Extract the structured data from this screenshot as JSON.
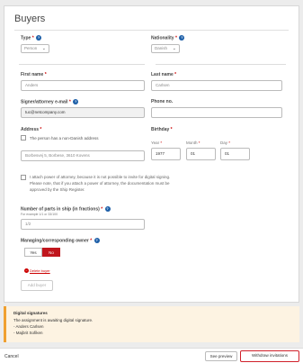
{
  "card": {
    "title": "Buyers"
  },
  "type": {
    "label": "Type",
    "selected": "Person"
  },
  "nationality": {
    "label": "Nationality",
    "selected": "Danish"
  },
  "first_name": {
    "label": "First name",
    "value": "Anders"
  },
  "last_name": {
    "label": "Last name",
    "value": "Carlsen"
  },
  "email": {
    "label": "Signer/attorney e-mail",
    "value": "tuc@netcompany.com"
  },
  "phone": {
    "label": "Phone no.",
    "value": ""
  },
  "address": {
    "label": "Address",
    "non_danish_label": "The person has a non-Danish address",
    "value": "Borbesvej 5, Borbese, 3610 Kovens"
  },
  "birthday": {
    "label": "Birthday",
    "year_label": "Year",
    "month_label": "Month",
    "day_label": "Day",
    "year": "1977",
    "month": "01",
    "day": "01"
  },
  "attorney": {
    "text": "I attach power of attorney, because it is not possible to invite for digital signing. Please note, that if you attach a power of attorney, the documentation must be approved by the Ship Register."
  },
  "parts": {
    "label": "Number of parts in ship (in fractions)",
    "hint": "For example 1/1 or 33/100",
    "value": "1/2"
  },
  "managing_owner": {
    "label": "Managing/corresponding owner",
    "yes": "Yes",
    "no": "No"
  },
  "delete_label": "Delete buyer",
  "add_label": "Add buyer",
  "signatures": {
    "title": "Digital signatures",
    "message": "The assignment is awaiting digital signature.",
    "signers": [
      "- Anders Carlsen",
      "- Majbrit Sofiken"
    ]
  },
  "footer": {
    "cancel": "Cancel",
    "preview": "See preview",
    "withdraw": "Withdraw invitations"
  },
  "colors": {
    "accent": "#c0161d",
    "help_icon": "#1d5fa8",
    "banner_border": "#f0a030"
  }
}
